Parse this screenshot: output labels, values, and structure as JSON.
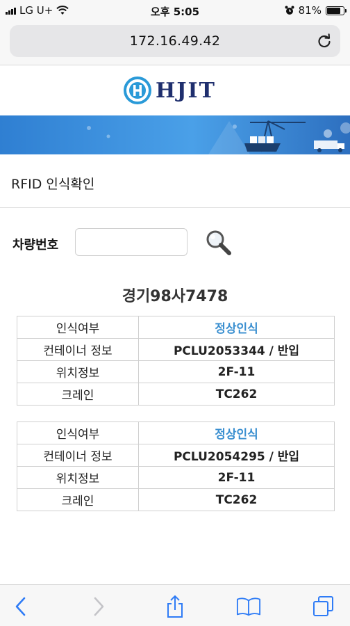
{
  "status_bar": {
    "carrier": "LG U+",
    "time": "오후 5:05",
    "battery": "81%",
    "battery_level": 0.81
  },
  "browser": {
    "url": "172.16.49.42"
  },
  "site": {
    "logo_text": "HJIT"
  },
  "page": {
    "title": "RFID 인식확인"
  },
  "search": {
    "label": "차량번호",
    "value": "",
    "placeholder": ""
  },
  "result": {
    "plate": "경기98사7478",
    "records": [
      {
        "rows": [
          {
            "label": "인식여부",
            "value": "정상인식"
          },
          {
            "label": "컨테이너 정보",
            "value": "PCLU2053344 / 반입"
          },
          {
            "label": "위치정보",
            "value": "2F-11"
          },
          {
            "label": "크레인",
            "value": "TC262"
          }
        ]
      },
      {
        "rows": [
          {
            "label": "인식여부",
            "value": "정상인식"
          },
          {
            "label": "컨테이너 정보",
            "value": "PCLU2054295 / 반입"
          },
          {
            "label": "위치정보",
            "value": "2F-11"
          },
          {
            "label": "크레인",
            "value": "TC262"
          }
        ]
      }
    ]
  },
  "icons": {
    "reload": "reload-icon",
    "search": "magnifier-icon",
    "back": "chevron-left-icon",
    "forward": "chevron-right-icon",
    "share": "share-icon",
    "bookmarks": "book-icon",
    "tabs": "tabs-icon"
  },
  "colors": {
    "status_ok": "#3a8fd0",
    "banner": "#3a8fe0",
    "logo": "#1f2f6e",
    "toolbar_blue": "#2f7cf6"
  }
}
